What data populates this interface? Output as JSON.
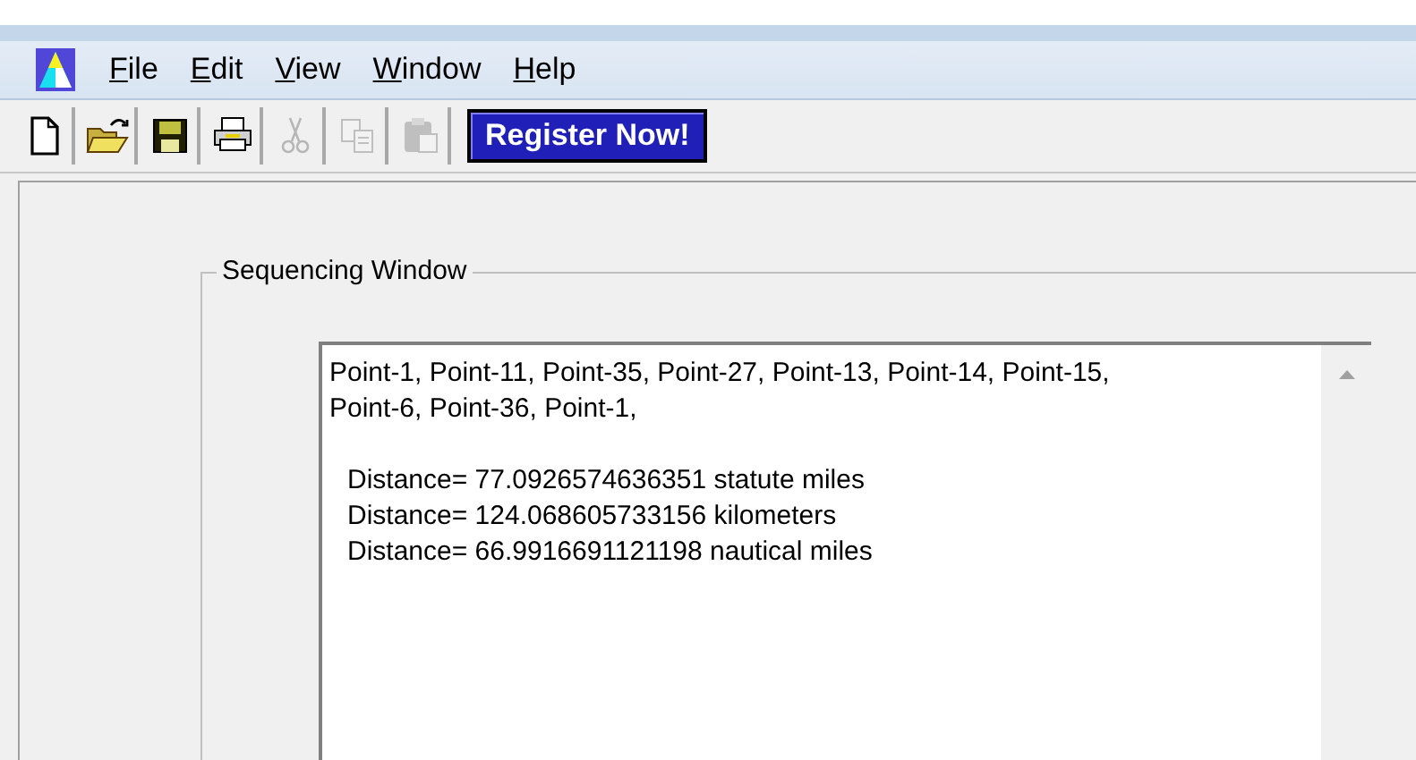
{
  "menu": [
    {
      "label": "File"
    },
    {
      "label": "Edit"
    },
    {
      "label": "View"
    },
    {
      "label": "Window"
    },
    {
      "label": "Help"
    }
  ],
  "toolbar": [
    {
      "kind": "new",
      "disabled": false
    },
    {
      "kind": "open",
      "disabled": false
    },
    {
      "kind": "save",
      "disabled": false
    },
    {
      "kind": "print",
      "disabled": false
    },
    {
      "kind": "cut",
      "disabled": true
    },
    {
      "kind": "copy",
      "disabled": true
    },
    {
      "kind": "paste",
      "disabled": true
    }
  ],
  "register_button": "Register Now!",
  "group": {
    "title": "Sequencing Window",
    "route_lines": [
      "Point-1, Point-11, Point-35, Point-27, Point-13, Point-14, Point-15,",
      "Point-6, Point-36, Point-1,"
    ],
    "distances": [
      "Distance=  77.0926574636351 statute miles",
      "Distance=  124.068605733156 kilometers",
      "Distance=  66.9916691121198 nautical miles"
    ]
  }
}
